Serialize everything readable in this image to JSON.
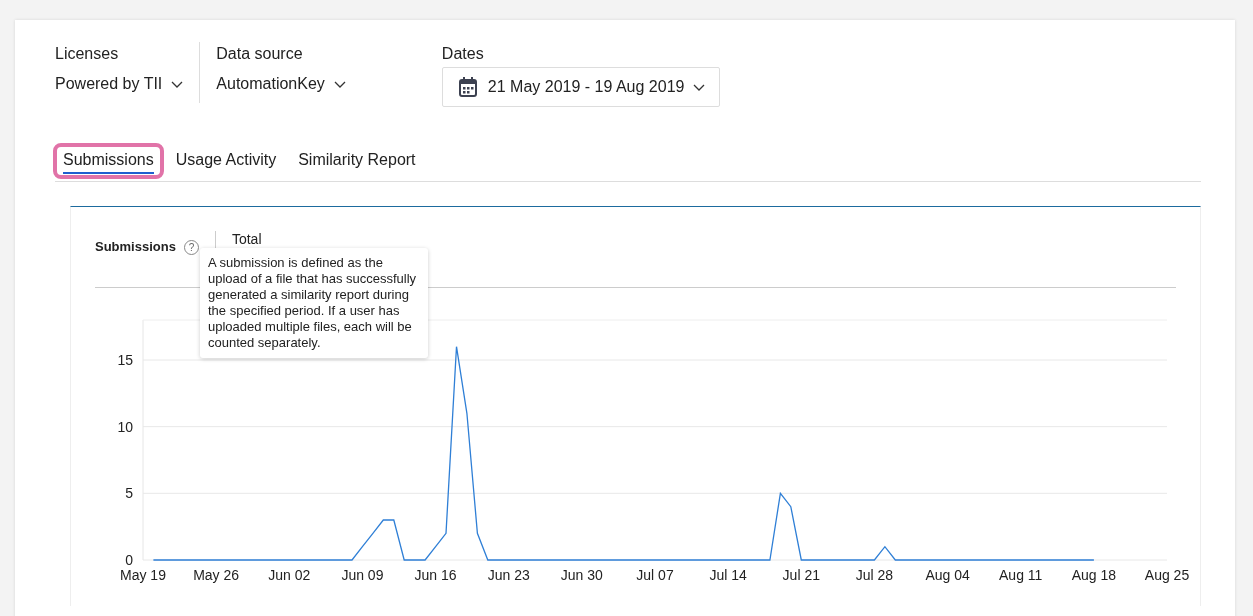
{
  "filters": [
    {
      "kind": "text",
      "label": "Licenses",
      "value": "Powered by TII"
    },
    {
      "kind": "text",
      "label": "Data source",
      "value": "AutomationKey"
    },
    {
      "kind": "date",
      "label": "Dates",
      "value": "21 May 2019 - 19 Aug 2019"
    }
  ],
  "tabs": [
    {
      "label": "Submissions",
      "selected": true,
      "focused": true
    },
    {
      "label": "Usage Activity",
      "selected": false,
      "focused": false
    },
    {
      "label": "Similarity Report",
      "selected": false,
      "focused": false
    }
  ],
  "panel": {
    "title": "Submissions",
    "help_icon": "?",
    "metric": "Total",
    "tooltip": "A submission is defined as the upload of a file that has successfully generated a similarity report during the specified period. If a user has uploaded multiple files, each will be counted separately.",
    "chart_data": {
      "type": "line",
      "categories": [
        "May 19",
        null,
        null,
        null,
        null,
        null,
        null,
        "May 26",
        null,
        null,
        null,
        null,
        null,
        null,
        "Jun 02",
        null,
        null,
        null,
        null,
        null,
        null,
        "Jun 09",
        null,
        null,
        null,
        null,
        null,
        null,
        "Jun 16",
        null,
        null,
        null,
        null,
        null,
        null,
        "Jun 23",
        null,
        null,
        null,
        null,
        null,
        null,
        "Jun 30",
        null,
        null,
        null,
        null,
        null,
        null,
        "Jul 07",
        null,
        null,
        null,
        null,
        null,
        null,
        "Jul 14",
        null,
        null,
        null,
        null,
        null,
        null,
        "Jul 21",
        null,
        null,
        null,
        null,
        null,
        null,
        "Jul 28",
        null,
        null,
        null,
        null,
        null,
        null,
        "Aug 04",
        null,
        null,
        null,
        null,
        null,
        null,
        "Aug 11",
        null,
        null,
        null,
        null,
        null,
        null,
        "Aug 18",
        null,
        null,
        null,
        null,
        null,
        null,
        "Aug 25"
      ],
      "series": [
        {
          "color": "#2f7fd6",
          "values": [
            null,
            0,
            0,
            0,
            0,
            0,
            0,
            0,
            0,
            0,
            0,
            0,
            0,
            0,
            0,
            0,
            0,
            0,
            0,
            0,
            0,
            1,
            2,
            3,
            3,
            0,
            0,
            0,
            1,
            2,
            16,
            11,
            2,
            0,
            0,
            0,
            0,
            0,
            0,
            0,
            0,
            0,
            0,
            0,
            0,
            0,
            0,
            0,
            0,
            0,
            0,
            0,
            0,
            0,
            0,
            0,
            0,
            0,
            0,
            0,
            0,
            5,
            4,
            0,
            0,
            0,
            0,
            0,
            0,
            0,
            0,
            1,
            0,
            0,
            0,
            0,
            0,
            0,
            0,
            0,
            0,
            0,
            0,
            0,
            0,
            0,
            0,
            0,
            0,
            0,
            0,
            0,
            null,
            null,
            null,
            null,
            null,
            null,
            null
          ]
        }
      ],
      "ylim": [
        0,
        18
      ],
      "grid": true,
      "yticks": [
        0,
        5,
        10,
        15
      ]
    }
  }
}
